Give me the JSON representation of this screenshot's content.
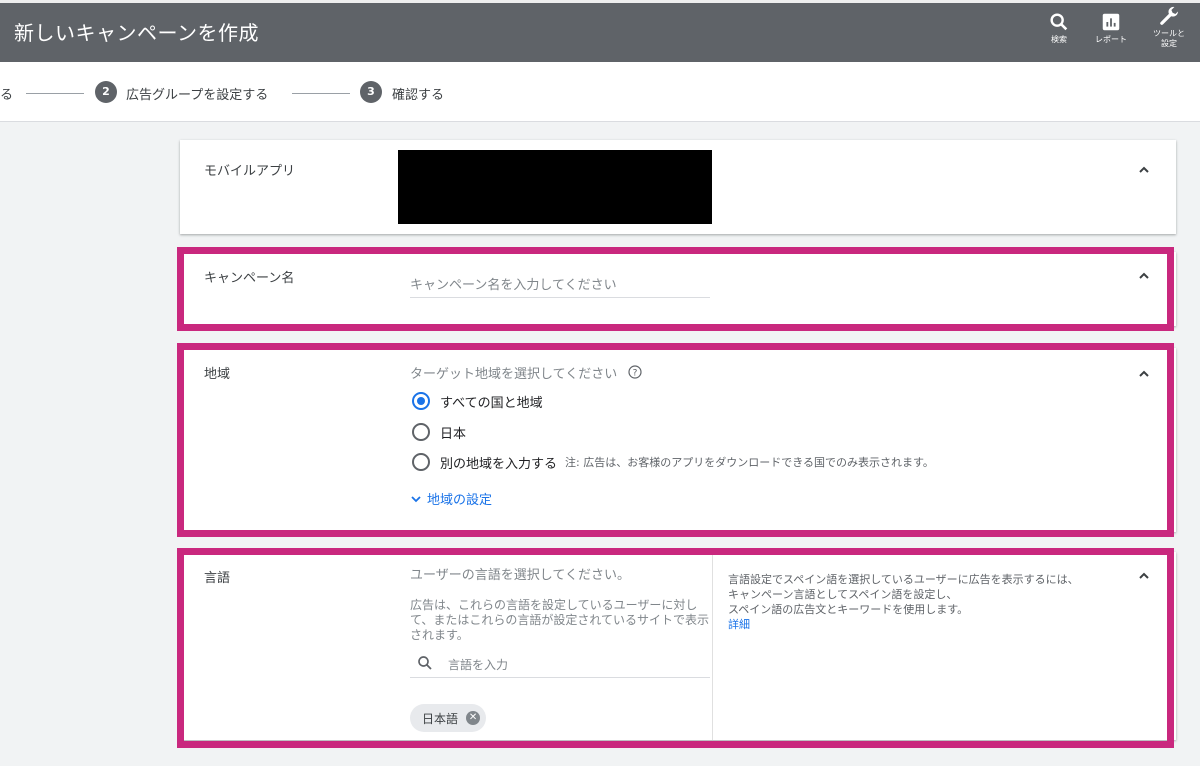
{
  "header": {
    "title": "新しいキャンペーンを作成",
    "tools": [
      {
        "icon": "search-icon",
        "label": "検索"
      },
      {
        "icon": "report-icon",
        "label": "レポート"
      },
      {
        "icon": "wrench-icon",
        "label_line1": "ツールと",
        "label_line2": "設定"
      }
    ]
  },
  "stepper": {
    "step1_tail": "る",
    "step2": {
      "number": "2",
      "label": "広告グループを設定する"
    },
    "step3": {
      "number": "3",
      "label": "確認する"
    }
  },
  "sections": {
    "app": {
      "label": "モバイルアプリ"
    },
    "campaign_name": {
      "label": "キャンペーン名",
      "placeholder": "キャンペーン名を入力してください"
    },
    "location": {
      "label": "地域",
      "hint": "ターゲット地域を選択してください",
      "options": [
        {
          "label": "すべての国と地域",
          "selected": true
        },
        {
          "label": "日本",
          "selected": false
        },
        {
          "label": "別の地域を入力する",
          "note": "注: 広告は、お客様のアプリをダウンロードできる国でのみ表示されます。",
          "selected": false
        }
      ],
      "settings_link": "地域の設定"
    },
    "language": {
      "label": "言語",
      "hint": "ユーザーの言語を選択してください。",
      "description": "広告は、これらの言語を設定しているユーザーに対して、またはこれらの言語が設定されているサイトで表示されます。",
      "search_placeholder": "言語を入力",
      "chip": "日本語",
      "side_note_line1": "言語設定でスペイン語を選択しているユーザーに広告を表示するには、",
      "side_note_line2": "キャンペーン言語としてスペイン語を設定し、",
      "side_note_line3": "スペイン語の広告文とキーワードを使用します。",
      "details_link": "詳細"
    }
  },
  "colors": {
    "highlight": "#c9287e",
    "appbar": "#5f6368",
    "accent": "#1a73e8"
  }
}
